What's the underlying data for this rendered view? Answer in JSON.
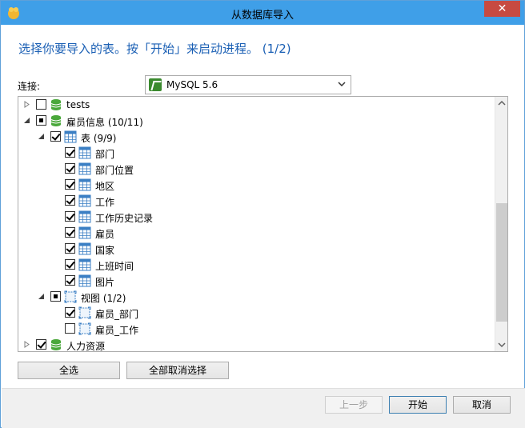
{
  "window": {
    "title": "从数据库导入"
  },
  "instruction": "选择你要导入的表。按「开始」来启动进程。 (1/2)",
  "connection": {
    "label": "连接:",
    "value": "MySQL 5.6"
  },
  "tree": [
    {
      "label": "tests",
      "check": "unchecked",
      "icon": "database-icon",
      "expander": "collapsed",
      "level": 0
    },
    {
      "label": "雇员信息 (10/11)",
      "check": "partial",
      "icon": "database-icon",
      "expander": "expanded",
      "level": 0
    },
    {
      "label": "表 (9/9)",
      "check": "checked",
      "icon": "table-icon",
      "expander": "expanded",
      "level": 1
    },
    {
      "label": "部门",
      "check": "checked",
      "icon": "table-icon",
      "expander": "none",
      "level": 2
    },
    {
      "label": "部门位置",
      "check": "checked",
      "icon": "table-icon",
      "expander": "none",
      "level": 2
    },
    {
      "label": "地区",
      "check": "checked",
      "icon": "table-icon",
      "expander": "none",
      "level": 2
    },
    {
      "label": "工作",
      "check": "checked",
      "icon": "table-icon",
      "expander": "none",
      "level": 2
    },
    {
      "label": "工作历史记录",
      "check": "checked",
      "icon": "table-icon",
      "expander": "none",
      "level": 2
    },
    {
      "label": "雇员",
      "check": "checked",
      "icon": "table-icon",
      "expander": "none",
      "level": 2
    },
    {
      "label": "国家",
      "check": "checked",
      "icon": "table-icon",
      "expander": "none",
      "level": 2
    },
    {
      "label": "上班时间",
      "check": "checked",
      "icon": "table-icon",
      "expander": "none",
      "level": 2
    },
    {
      "label": "图片",
      "check": "checked",
      "icon": "table-icon",
      "expander": "none",
      "level": 2
    },
    {
      "label": "视图 (1/2)",
      "check": "partial",
      "icon": "view-icon",
      "expander": "expanded",
      "level": 1
    },
    {
      "label": "雇员_部门",
      "check": "checked",
      "icon": "view-icon",
      "expander": "none",
      "level": 2
    },
    {
      "label": "雇员_工作",
      "check": "unchecked",
      "icon": "view-icon",
      "expander": "none",
      "level": 2
    },
    {
      "label": "人力资源",
      "check": "checked",
      "icon": "database-icon",
      "expander": "collapsed",
      "level": 0
    }
  ],
  "buttons": {
    "select_all": "全选",
    "deselect_all": "全部取消选择",
    "prev": "上一步",
    "start": "开始",
    "cancel": "取消"
  },
  "colors": {
    "titlebar": "#3f9fe8",
    "instruction": "#1a5fb4",
    "database": "#4aa83a",
    "table": "#3b7fc4",
    "close": "#c74a41"
  }
}
